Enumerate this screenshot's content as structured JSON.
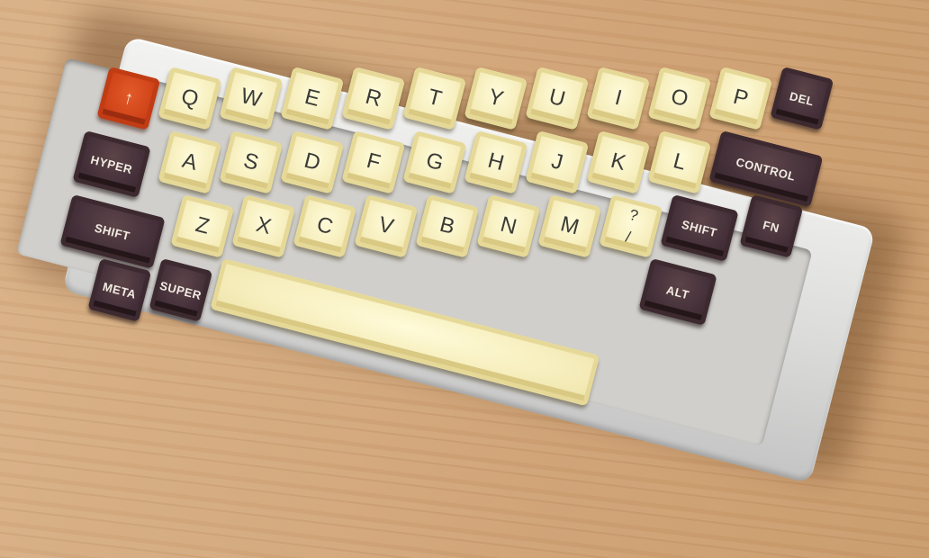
{
  "scene": {
    "subject": "mechanical-keyboard",
    "colors": {
      "case": "#dcdcdb",
      "cream_key": "#f4ecbb",
      "dark_key": "#45303a",
      "accent_key": "#cf4318",
      "desk": "#d3a97d"
    }
  },
  "keys": {
    "escape": "↑",
    "q": "Q",
    "w": "W",
    "e": "E",
    "r": "R",
    "t": "T",
    "y": "Y",
    "u": "U",
    "i": "I",
    "o": "O",
    "p": "P",
    "hyper": "HYPER",
    "a": "A",
    "s": "S",
    "d": "D",
    "f": "F",
    "g": "G",
    "h": "H",
    "j": "J",
    "k": "K",
    "l": "L",
    "del": "DEL",
    "shift_left": "SHIFT",
    "z": "Z",
    "x": "X",
    "c": "C",
    "v": "V",
    "b": "B",
    "n": "N",
    "m": "M",
    "slash_top": "?",
    "slash_bottom": "/",
    "control": "CONTROL",
    "meta": "META",
    "super": "SUPER",
    "space": "",
    "shift_right": "SHIFT",
    "fn": "FN",
    "alt": "ALT"
  }
}
